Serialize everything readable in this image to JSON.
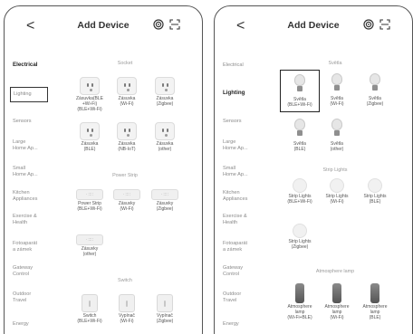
{
  "left": {
    "header": {
      "title": "Add Device",
      "back_glyph": "<"
    },
    "categories": [
      {
        "label": "Electrical",
        "state": "active"
      },
      {
        "label": "Lighting",
        "state": "boxed"
      },
      {
        "label": "Sensors",
        "state": "normal"
      },
      {
        "label": "Large\nHome Ap...",
        "state": "normal"
      },
      {
        "label": "Small\nHome Ap...",
        "state": "normal"
      },
      {
        "label": "Kitchen\nAppliances",
        "state": "normal"
      },
      {
        "label": "Exercise &\nHealth",
        "state": "normal"
      },
      {
        "label": "Fotoaparát\na zámek",
        "state": "normal"
      },
      {
        "label": "Gateway\nControl",
        "state": "normal"
      },
      {
        "label": "Outdoor\nTravel",
        "state": "normal"
      },
      {
        "label": "Energy",
        "state": "normal"
      }
    ],
    "sections": [
      {
        "title": "Socket",
        "icon": "socket-icon",
        "items": [
          "Zásuvka(BLE\n+Wi-Fi)\n(BLE+Wi-Fi)",
          "Zásuvka\n(Wi-Fi)",
          "Zásuvka\n(Zigbee)",
          "Zásuvka\n(BLE)",
          "Zásuvka\n(NB-IoT)",
          "Zásuvka\n(other)"
        ]
      },
      {
        "title": "Power Strip",
        "icon": "power-strip-icon",
        "items": [
          "Power Strip\n(BLE+Wi-Fi)",
          "Zásuvky\n(Wi-Fi)",
          "Zásuvky\n(Zigbee)",
          "Zásuvky\n(other)"
        ]
      },
      {
        "title": "Switch",
        "icon": "switch-icon",
        "items": [
          "Switch\n(BLE+Wi-Fi)",
          "Vypínač\n(Wi-Fi)",
          "Vypínač\n(Zigbee)"
        ]
      }
    ]
  },
  "right": {
    "header": {
      "title": "Add Device",
      "back_glyph": "<"
    },
    "categories": [
      {
        "label": "Electrical",
        "state": "normal"
      },
      {
        "label": "Lighting",
        "state": "active"
      },
      {
        "label": "Sensors",
        "state": "normal"
      },
      {
        "label": "Large\nHome Ap...",
        "state": "normal"
      },
      {
        "label": "Small\nHome Ap...",
        "state": "normal"
      },
      {
        "label": "Kitchen\nAppliances",
        "state": "normal"
      },
      {
        "label": "Exercise &\nHealth",
        "state": "normal"
      },
      {
        "label": "Fotoaparát\na zámek",
        "state": "normal"
      },
      {
        "label": "Gateway\nControl",
        "state": "normal"
      },
      {
        "label": "Outdoor\nTravel",
        "state": "normal"
      },
      {
        "label": "Energy",
        "state": "normal"
      }
    ],
    "sections": [
      {
        "title": "Světla",
        "icon": "bulb-icon",
        "items": [
          "Světla\n(BLE+Wi-Fi)",
          "Světla\n(Wi-Fi)",
          "Světla\n(Zigbee)",
          "Světla\n(BLE)",
          "Světla\n(other)"
        ],
        "selected_index": 0
      },
      {
        "title": "Strip Lights",
        "icon": "strip-light-icon",
        "items": [
          "Strip Lights\n(BLE+Wi-Fi)",
          "Strip Lights\n(Wi-Fi)",
          "Strip Lights\n(BLE)",
          "Strip Lights\n(Zigbee)"
        ]
      },
      {
        "title": "Atmosphere lamp",
        "icon": "atmosphere-lamp-icon",
        "items": [
          "Atmosphere\nlamp\n(Wi-Fi+BLE)",
          "Atmosphere\nlamp\n(Wi-Fi)",
          "Atmosphere\nlamp\n(BLE)"
        ]
      }
    ]
  },
  "strip_glyph": "· ∷∷",
  "colors": {
    "selected_border": "#222222",
    "muted_text": "#8a8a8a"
  }
}
